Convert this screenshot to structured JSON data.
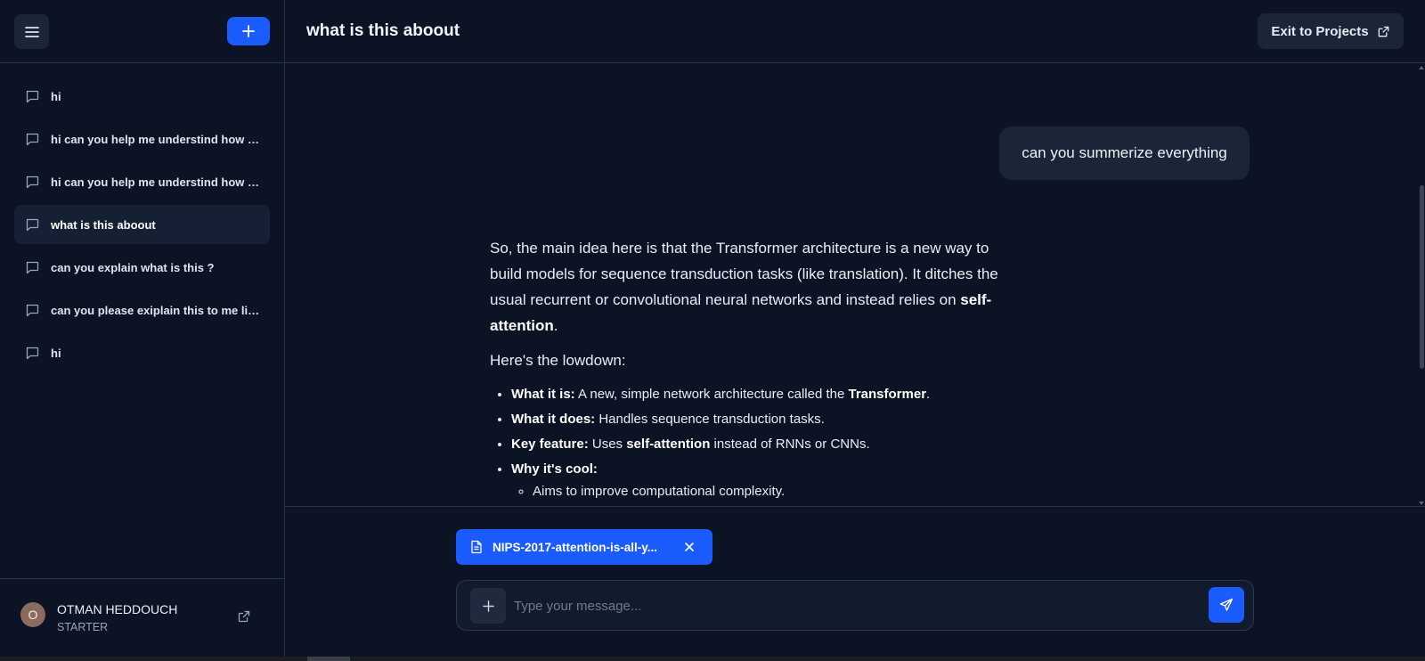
{
  "sidebar": {
    "items": [
      {
        "label": "hi"
      },
      {
        "label": "hi can you help me understind how this works"
      },
      {
        "label": "hi can you help me understind how this works"
      },
      {
        "label": "what is this aboout"
      },
      {
        "label": "can you explain what is this ?"
      },
      {
        "label": "can you please exiplain this to me like im five"
      },
      {
        "label": "hi"
      }
    ],
    "active_index": 3,
    "user": {
      "initial": "O",
      "name": "OTMAN HEDDOUCH",
      "plan": "STARTER"
    }
  },
  "header": {
    "title": "what is this aboout",
    "exit_label": "Exit to Projects"
  },
  "conversation": {
    "user_message": "can you summerize everything",
    "assistant": {
      "intro_prefix": "So, the main idea here is that the Transformer architecture is a new way to build models for sequence transduction tasks (like translation). It ditches the usual recurrent or convolutional neural networks and instead relies on ",
      "intro_bold": "self-attention",
      "intro_suffix": ".",
      "lowdown": "Here's the lowdown:",
      "bullets": [
        {
          "label": "What it is:",
          "text": " A new, simple network architecture called the ",
          "bold": "Transformer",
          "suffix": "."
        },
        {
          "label": "What it does:",
          "text": " Handles sequence transduction tasks.",
          "bold": "",
          "suffix": ""
        },
        {
          "label": "Key feature:",
          "text": " Uses ",
          "bold": "self-attention",
          "suffix": " instead of RNNs or CNNs."
        },
        {
          "label": "Why it's cool:",
          "text": "",
          "bold": "",
          "suffix": ""
        }
      ],
      "sub_bullet": "Aims to improve computational complexity."
    }
  },
  "attachment": {
    "name": "NIPS-2017-attention-is-all-y..."
  },
  "composer": {
    "placeholder": "Type your message..."
  },
  "colors": {
    "accent": "#1a5cff",
    "background": "#0b1324",
    "surface": "#1b2538"
  }
}
